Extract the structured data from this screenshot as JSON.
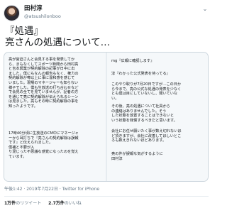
{
  "author": {
    "name": "田村淳",
    "handle": "@atsushilonboo"
  },
  "tweet": {
    "text_line1": "『処遇』",
    "text_line2": "亮さんの処遇について…"
  },
  "media": {
    "left_paragraphs": [
      "亮が宮迫さんと会見する事を発表してか\nら、まもなくしてスポーツ新聞から田村亮\nと吉本興業が契約解除の記事が日中に出\nました。僕にもなんの報告もなく、権力の\n契約解除が噂以上に事に違和感を感じて\nいました。現場のマネージャーも知らない\n様子でした。僕も生放送の打ち合わせなど\nで会見の全てを見ていませんが、記者の方\nを通じて亮に契約解除が伝えられるシーン\nは見ました。亮もその時に契約解除の事を\n知ったようです。",
      "17時40分頃に生放送のCM中にマネージャ\nーから耳打ちで『亮さんの契約解除は誤報\nです』と伝えられました。\n僕補と不要が入\nり混じった不思議な感覚になったのを覚え\nています。"
    ],
    "right_paragraphs": [
      "mg『広報に確認します』",
      "淳『わかった公式発表を待ってる』",
      "このやり取りが7月20日ですが…この日か\nら今まで、亮の公式な処遇の発表を少なく\nとも僕は目にしていないし、聞いていな\nい。",
      "その後、亮の処遇について社員から\nの連絡はありませんでした。そう\nした状態を放置することはできないと\nいう状態を我慢するべきだと思います。",
      "会社にお任せ願いたく事が数え切れないほ\nど頂きますが、会社に改善してほしいとこ\nろも数えきれないほどあります。",
      "亮の件が誤報な気がするように\n田村淳"
    ]
  },
  "meta": {
    "timestamp": "午後1:42 · 2019年7月22日 · Twitter for iPhone"
  },
  "stats": {
    "retweets_count": "1万件",
    "retweets_label": "のリツイート",
    "likes_count": "2.7万件",
    "likes_label": "のいいね"
  }
}
